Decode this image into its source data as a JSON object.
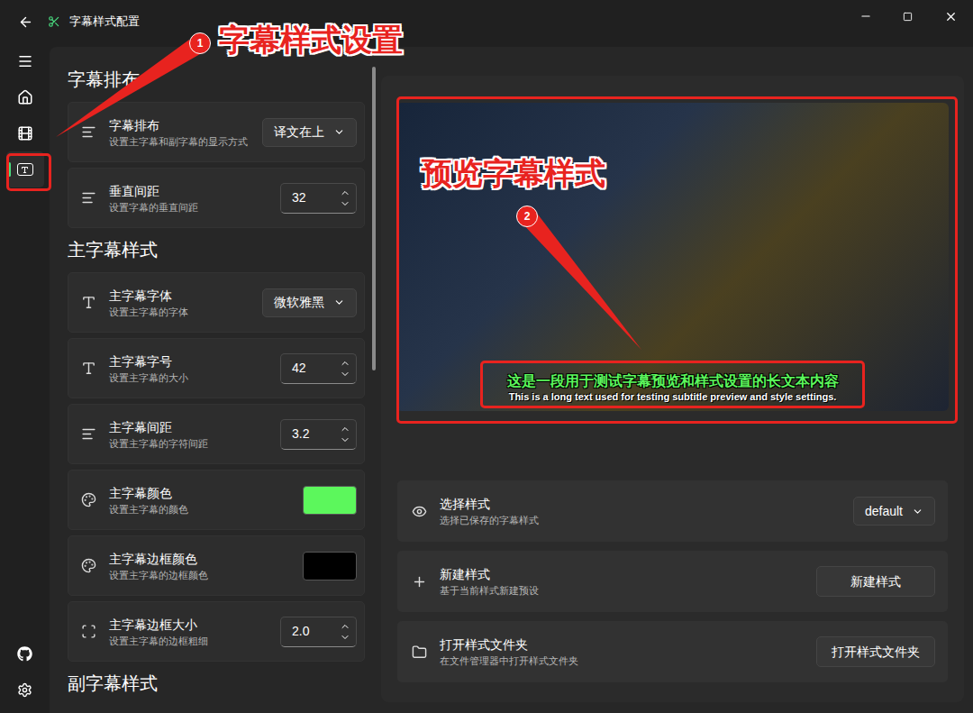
{
  "window": {
    "title": "字幕样式配置"
  },
  "nav": {
    "top": [
      {
        "selected": false
      },
      {
        "selected": false
      },
      {
        "selected": false
      },
      {
        "selected": true
      }
    ],
    "bottom": [
      {
        "selected": false
      },
      {
        "selected": false
      }
    ]
  },
  "settings": {
    "scrollbar": {
      "level": 0.47
    },
    "sections": [
      {
        "title": "字幕排布",
        "rows": [
          {
            "kind": "select",
            "label": "字幕排布",
            "description": "设置主字幕和副字幕的显示方式",
            "value": "译文在上"
          },
          {
            "kind": "spin",
            "label": "垂直间距",
            "description": "设置字幕的垂直间距",
            "value": "32"
          }
        ]
      },
      {
        "title": "主字幕样式",
        "rows": [
          {
            "kind": "select",
            "label": "主字幕字体",
            "description": "设置主字幕的字体",
            "value": "微软雅黑"
          },
          {
            "kind": "spin",
            "label": "主字幕字号",
            "description": "设置主字幕的大小",
            "value": "42"
          },
          {
            "kind": "spin",
            "label": "主字幕间距",
            "description": "设置主字幕的字符间距",
            "value": "3.2"
          },
          {
            "kind": "color",
            "label": "主字幕颜色",
            "description": "设置主字幕的颜色",
            "color": "#5cf75c"
          },
          {
            "kind": "color",
            "label": "主字幕边框颜色",
            "description": "设置主字幕的边框颜色",
            "color": "#000000"
          },
          {
            "kind": "spin",
            "label": "主字幕边框大小",
            "description": "设置主字幕的边框粗细",
            "value": "2.0"
          }
        ]
      },
      {
        "title": "副字幕样式",
        "rows": []
      }
    ]
  },
  "preview": {
    "main": "这是一段用于测试字幕预览和样式设置的长文本内容",
    "sub": "This is a long text used for testing subtitle preview and style settings."
  },
  "actions": [
    {
      "kind": "select",
      "label": "选择样式",
      "description": "选择已保存的字幕样式",
      "value": "default"
    },
    {
      "kind": "button",
      "label": "新建样式",
      "description": "基于当前样式新建预设",
      "value": "新建样式"
    },
    {
      "kind": "button",
      "label": "打开样式文件夹",
      "description": "在文件管理器中打开样式文件夹",
      "value": "打开样式文件夹"
    }
  ],
  "annotations": [
    {
      "number": "1",
      "label": "字幕样式设置"
    },
    {
      "number": "2",
      "label": "预览字幕样式"
    }
  ]
}
